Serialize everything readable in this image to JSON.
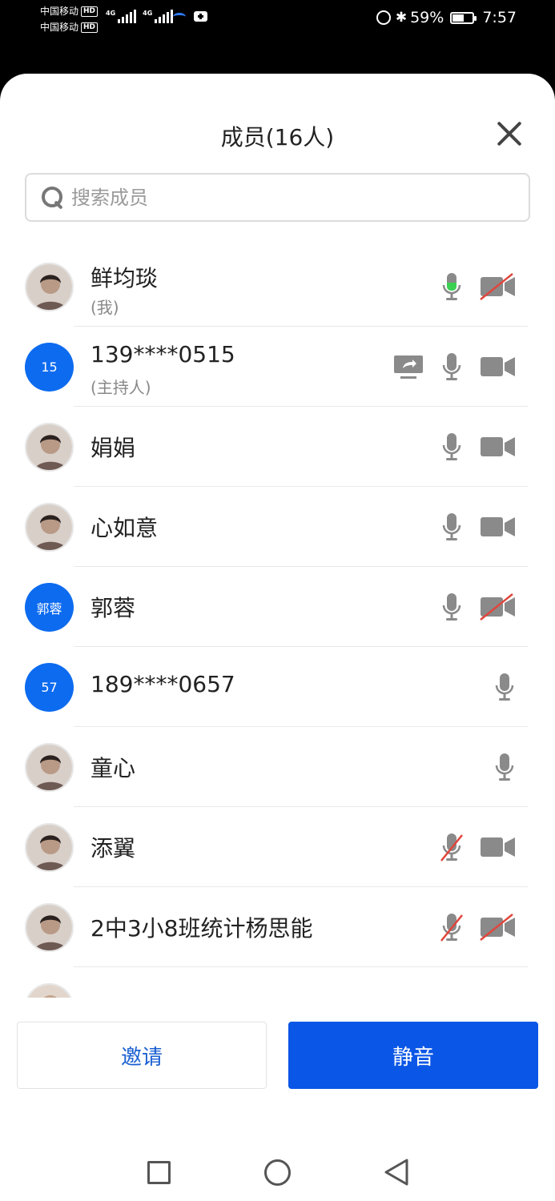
{
  "status_bar": {
    "carrier1": "中国移动",
    "carrier2": "中国移动",
    "hd": "HD",
    "net": "4G",
    "battery_text": "59%",
    "battery_level": 0.59,
    "time": "7:57"
  },
  "sheet": {
    "title": "成员(16人)",
    "search_placeholder": "搜索成员",
    "members": [
      {
        "name": "鲜均琰",
        "sub": "(我)",
        "avatar": "photo",
        "mic": "speaking",
        "cam": "off"
      },
      {
        "name": "139****0515",
        "sub": "(主持人)",
        "avatar_text": "15",
        "share": true,
        "mic": "on",
        "cam": "on"
      },
      {
        "name": "娟娟",
        "avatar": "photo",
        "mic": "on",
        "cam": "on"
      },
      {
        "name": "心如意",
        "avatar": "photo",
        "mic": "on",
        "cam": "on"
      },
      {
        "name": "郭蓉",
        "avatar_text": "郭蓉",
        "mic": "on",
        "cam": "off"
      },
      {
        "name": "189****0657",
        "avatar_text": "57",
        "mic": "on"
      },
      {
        "name": "童心",
        "avatar": "photo",
        "mic": "on"
      },
      {
        "name": "添翼",
        "avatar": "photo",
        "mic": "off",
        "cam": "on"
      },
      {
        "name": "2中3小8班统计杨思能",
        "avatar": "photo",
        "mic": "off",
        "cam": "off"
      }
    ],
    "invite_label": "邀请",
    "mute_label": "静音"
  },
  "colors": {
    "accent": "#0a56e6",
    "avatar_blue": "#0d6bf0",
    "icon_gray": "#8a8a8a",
    "disabled_red": "#e0463c",
    "speaking_green": "#3ad153"
  }
}
